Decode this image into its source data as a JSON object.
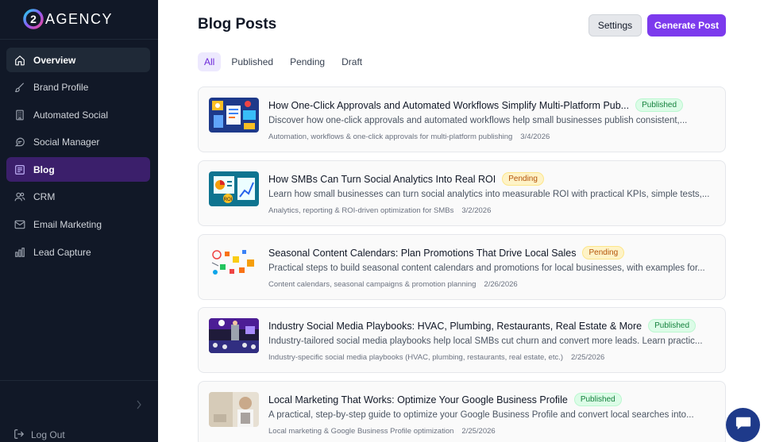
{
  "brand": {
    "logo_letter": "2",
    "name": "AGENCY"
  },
  "sidebar": {
    "items": [
      {
        "label": "Overview",
        "icon": "home-icon",
        "state": "active-gray"
      },
      {
        "label": "Brand Profile",
        "icon": "brush-icon",
        "state": ""
      },
      {
        "label": "Automated Social",
        "icon": "building-icon",
        "state": ""
      },
      {
        "label": "Social Manager",
        "icon": "message-icon",
        "state": ""
      },
      {
        "label": "Blog",
        "icon": "blog-icon",
        "state": "active-purple"
      },
      {
        "label": "CRM",
        "icon": "users-icon",
        "state": ""
      },
      {
        "label": "Email Marketing",
        "icon": "mail-icon",
        "state": ""
      },
      {
        "label": "Lead Capture",
        "icon": "bar-chart-icon",
        "state": ""
      }
    ],
    "logout_label": "Log Out"
  },
  "header": {
    "title": "Blog Posts",
    "settings_label": "Settings",
    "generate_label": "Generate Post"
  },
  "tabs": [
    {
      "label": "All",
      "active": true
    },
    {
      "label": "Published",
      "active": false
    },
    {
      "label": "Pending",
      "active": false
    },
    {
      "label": "Draft",
      "active": false
    }
  ],
  "posts": [
    {
      "title": "How One-Click Approvals and Automated Workflows Simplify Multi-Platform Pub...",
      "status": "Published",
      "description": "Discover how one-click approvals and automated workflows help small businesses publish consistent,...",
      "category": "Automation, workflows & one-click approvals for multi-platform publishing",
      "date": "3/4/2026"
    },
    {
      "title": "How SMBs Can Turn Social Analytics Into Real ROI",
      "status": "Pending",
      "description": "Learn how small businesses can turn social analytics into measurable ROI with practical KPIs, simple tests,...",
      "category": "Analytics, reporting & ROI-driven optimization for SMBs",
      "date": "3/2/2026"
    },
    {
      "title": "Seasonal Content Calendars: Plan Promotions That Drive Local Sales",
      "status": "Pending",
      "description": "Practical steps to build seasonal content calendars and promotions for local businesses, with examples for...",
      "category": "Content calendars, seasonal campaigns & promotion planning",
      "date": "2/26/2026"
    },
    {
      "title": "Industry Social Media Playbooks: HVAC, Plumbing, Restaurants, Real Estate & More",
      "status": "Published",
      "description": "Industry-tailored social media playbooks help local SMBs cut churn and convert more leads. Learn practic...",
      "category": "Industry-specific social media playbooks (HVAC, plumbing, restaurants, real estate, etc.)",
      "date": "2/25/2026"
    },
    {
      "title": "Local Marketing That Works: Optimize Your Google Business Profile",
      "status": "Published",
      "description": "A practical, step-by-step guide to optimize your Google Business Profile and convert local searches into...",
      "category": "Local marketing & Google Business Profile optimization",
      "date": "2/25/2026"
    }
  ],
  "colors": {
    "sidebar_bg": "#111827",
    "accent": "#7c3aed",
    "published": "#15803d",
    "pending": "#b45309"
  }
}
